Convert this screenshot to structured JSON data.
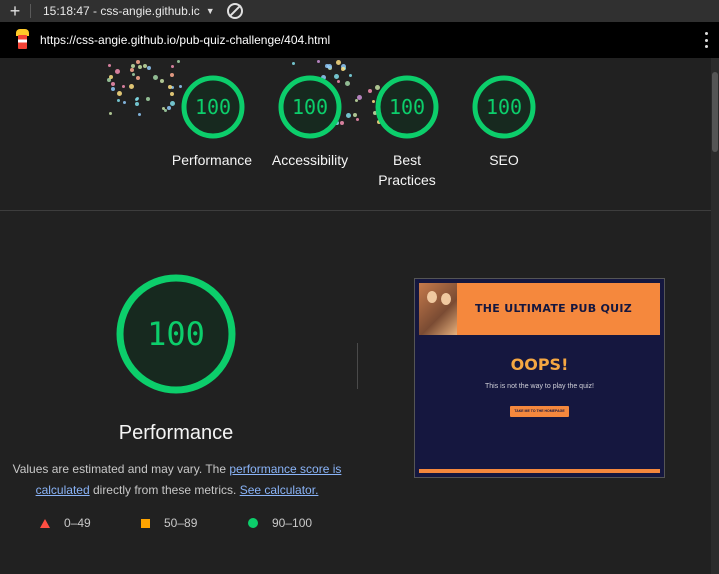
{
  "topbar": {
    "new_tab_label": "+",
    "tab_title": "15:18:47 - css-angie.github.ic",
    "caret": "▼"
  },
  "urlbar": {
    "url": "https://css-angie.github.io/pub-quiz-challenge/404.html"
  },
  "summary": [
    {
      "score": "100",
      "label": "Performance"
    },
    {
      "score": "100",
      "label": "Accessibility"
    },
    {
      "score": "100",
      "label": "Best Practices"
    },
    {
      "score": "100",
      "label": "SEO"
    }
  ],
  "performance": {
    "score": "100",
    "title": "Performance",
    "desc_before": "Values are estimated and may vary. The ",
    "link_score": "performance score is calculated",
    "desc_middle": " directly from these metrics. ",
    "link_calc": "See calculator."
  },
  "legend": {
    "fail": "0–49",
    "average": "50–89",
    "pass": "90–100"
  },
  "screenshot": {
    "header_title": "THE ULTIMATE PUB QUIZ",
    "heading": "OOPS!",
    "message": "This is not the way to play the quiz!",
    "button": "TAKE ME TO THE HOMEPAGE"
  },
  "colors": {
    "pass": "#0cce6b",
    "average": "#ffa400",
    "fail": "#ff4e42",
    "link": "#8ab4f8",
    "background": "#212121"
  }
}
